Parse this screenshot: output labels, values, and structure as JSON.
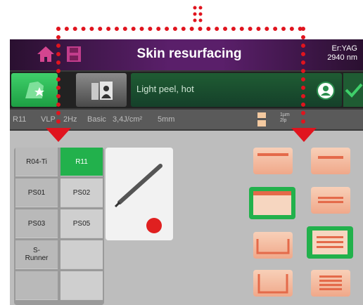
{
  "header": {
    "title": "Skin resurfacing",
    "laser_line1": "Er:YAG",
    "laser_line2": "2940 nm"
  },
  "preset": {
    "label": "Light peel, hot"
  },
  "params": {
    "handpiece": "R11",
    "mode": "VLP",
    "frequency": "2Hz",
    "basic": "Basic",
    "fluence": "3,4J/cm²",
    "spot": "5mm",
    "extra_line1": "1µm",
    "extra_line2": "2lp"
  },
  "handpieces": [
    [
      "R04-Ti",
      "R11"
    ],
    [
      "PS01",
      "PS02"
    ],
    [
      "PS03",
      "PS05"
    ],
    [
      "S-\nRunner",
      ""
    ],
    [
      "",
      ""
    ]
  ],
  "selected_handpiece": "R11",
  "colors": {
    "accent": "#22b14c",
    "callout": "#e0141e"
  }
}
